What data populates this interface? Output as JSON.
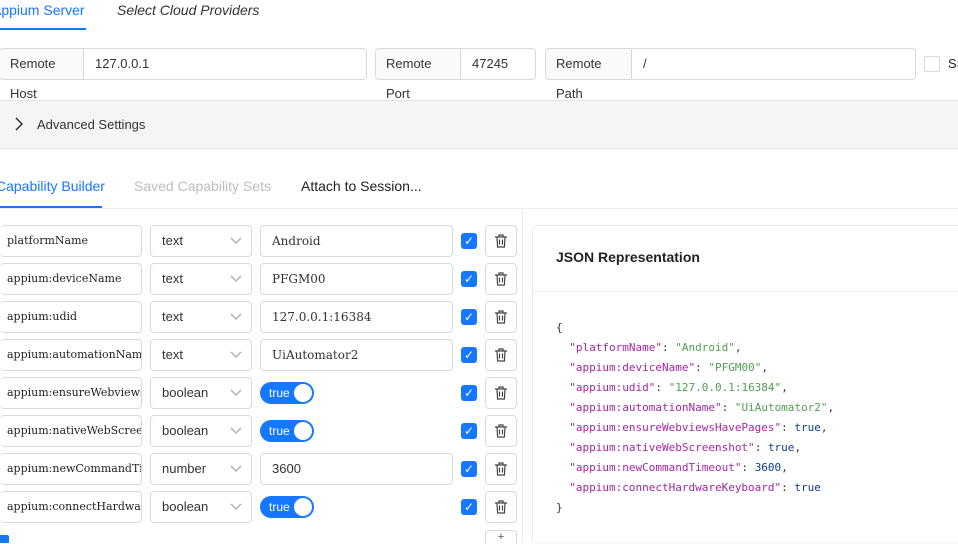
{
  "top_tabs": [
    {
      "label": "Appium Server"
    },
    {
      "label": "Select Cloud Providers"
    }
  ],
  "server": {
    "host_label": "Remote Host",
    "host_value": "127.0.0.1",
    "port_label": "Remote Port",
    "port_value": "47245",
    "path_label": "Remote Path",
    "path_value": "/",
    "ssl_label": "SSL"
  },
  "advanced": {
    "label": "Advanced Settings"
  },
  "cap_tabs": [
    {
      "label": "Capability Builder"
    },
    {
      "label": "Saved Capability Sets"
    },
    {
      "label": "Attach to Session..."
    }
  ],
  "capabilities": [
    {
      "name": "platformName",
      "type": "text",
      "value": "Android"
    },
    {
      "name": "appium:deviceName",
      "type": "text",
      "value": "PFGM00"
    },
    {
      "name": "appium:udid",
      "type": "text",
      "value": "127.0.0.1:16384"
    },
    {
      "name": "appium:automationName",
      "type": "text",
      "value": "UiAutomator2"
    },
    {
      "name": "appium:ensureWebviewsHavePages",
      "type": "boolean",
      "value": "true"
    },
    {
      "name": "appium:nativeWebScreenshot",
      "type": "boolean",
      "value": "true"
    },
    {
      "name": "appium:newCommandTimeout",
      "type": "number",
      "value": "3600"
    },
    {
      "name": "appium:connectHardwareKeyboard",
      "type": "boolean",
      "value": "true"
    }
  ],
  "json_panel": {
    "title": "JSON Representation",
    "open_brace": "{",
    "close_brace": "}",
    "lines": [
      {
        "key": "\"platformName\"",
        "val": "\"Android\"",
        "kind": "s",
        "comma": ","
      },
      {
        "key": "\"appium:deviceName\"",
        "val": "\"PFGM00\"",
        "kind": "s",
        "comma": ","
      },
      {
        "key": "\"appium:udid\"",
        "val": "\"127.0.0.1:16384\"",
        "kind": "s",
        "comma": ","
      },
      {
        "key": "\"appium:automationName\"",
        "val": "\"UiAutomator2\"",
        "kind": "s",
        "comma": ","
      },
      {
        "key": "\"appium:ensureWebviewsHavePages\"",
        "val": "true",
        "kind": "b",
        "comma": ","
      },
      {
        "key": "\"appium:nativeWebScreenshot\"",
        "val": "true",
        "kind": "b",
        "comma": ","
      },
      {
        "key": "\"appium:newCommandTimeout\"",
        "val": "3600",
        "kind": "n",
        "comma": ","
      },
      {
        "key": "\"appium:connectHardwareKeyboard\"",
        "val": "true",
        "kind": "b",
        "comma": ""
      }
    ]
  },
  "colors": {
    "accent": "#1677ff"
  },
  "icons": {
    "delete": "trash-icon",
    "expand": "chevron-right-icon",
    "select": "chevron-down-icon",
    "checked": "check-icon"
  }
}
